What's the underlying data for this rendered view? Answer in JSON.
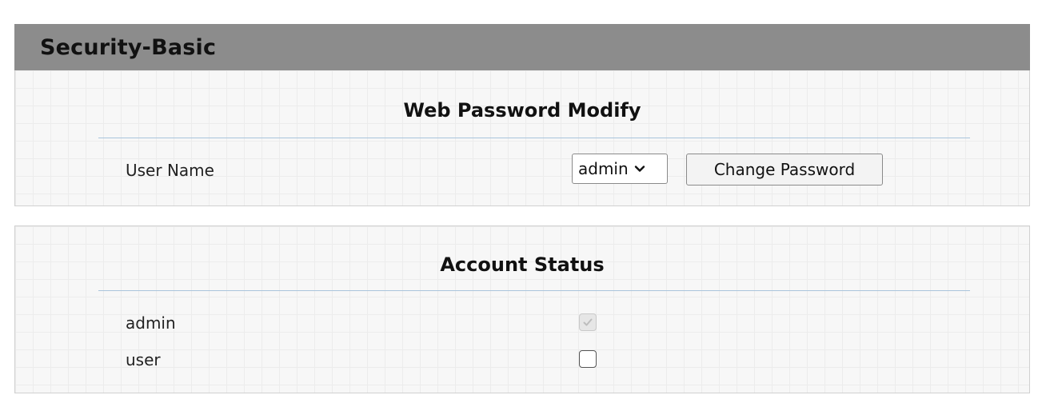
{
  "header": {
    "title": "Security-Basic"
  },
  "web_password": {
    "title": "Web Password Modify",
    "user_name_label": "User Name",
    "user_select": {
      "value": "admin",
      "options": [
        "admin"
      ]
    },
    "change_password_label": "Change Password"
  },
  "account_status": {
    "title": "Account Status",
    "accounts": [
      {
        "label": "admin",
        "checked": true,
        "disabled": true
      },
      {
        "label": "user",
        "checked": false,
        "disabled": false
      }
    ]
  },
  "icons": {
    "select_arrow": "chevron-down-icon",
    "check": "checkmark-icon"
  },
  "colors": {
    "header_bg": "#8c8c8c",
    "divider": "#a9c4dc",
    "panel_bg": "#f7f7f7"
  }
}
